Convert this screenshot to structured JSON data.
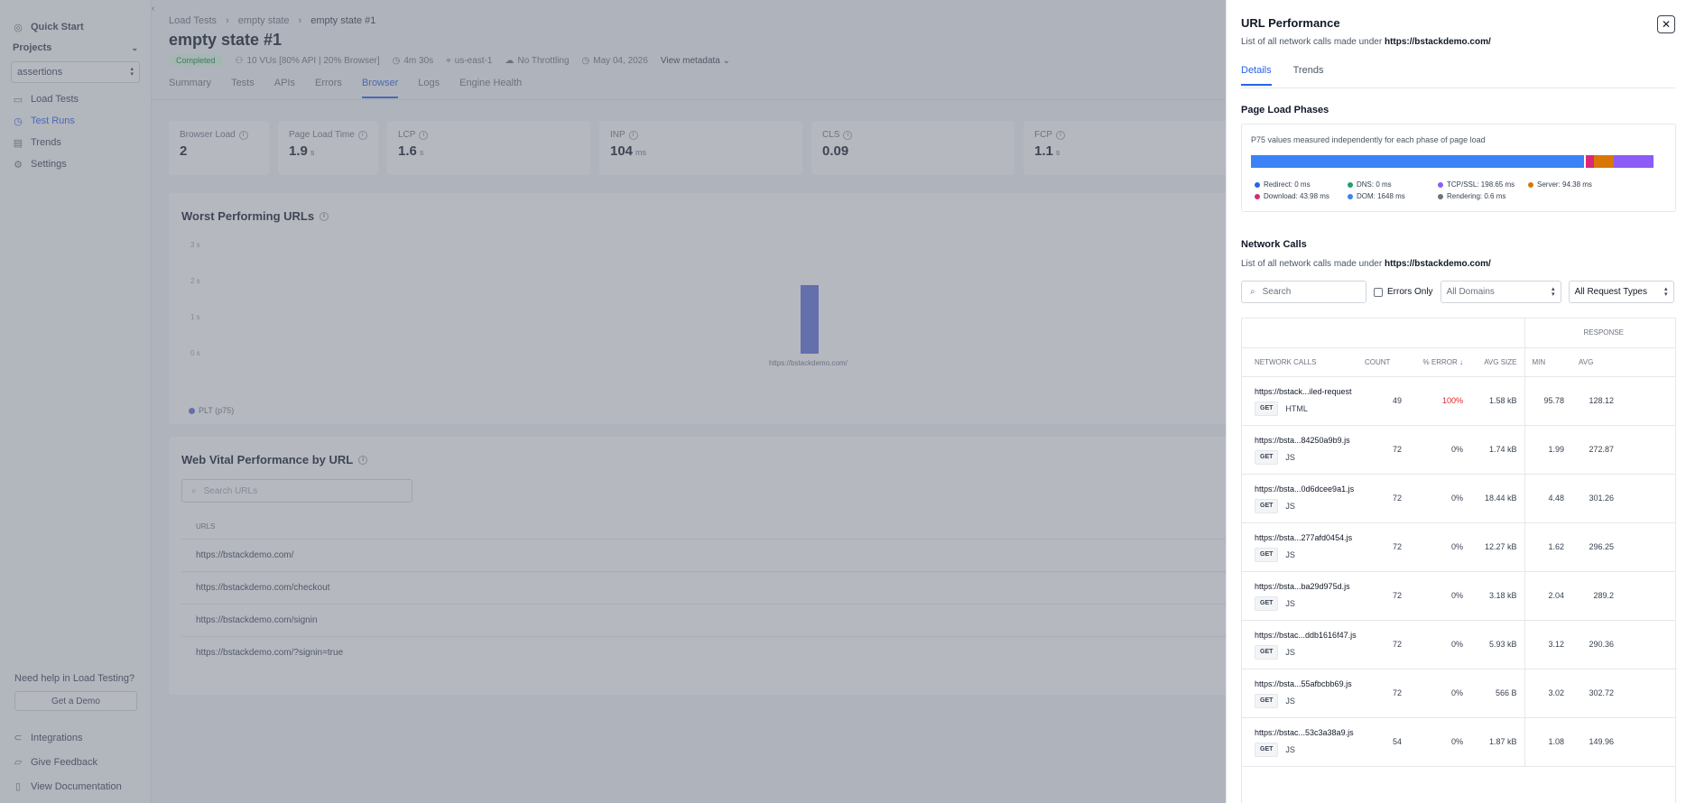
{
  "sidebar": {
    "quick_start": "Quick Start",
    "projects_label": "Projects",
    "project_value": "assertions",
    "load_tests": "Load Tests",
    "test_runs": "Test Runs",
    "trends": "Trends",
    "settings": "Settings",
    "help_text": "Need help in Load Testing?",
    "demo_button": "Get a Demo",
    "integrations": "Integrations",
    "feedback": "Give Feedback",
    "docs": "View Documentation"
  },
  "main": {
    "breadcrumb": [
      "Load Tests",
      "empty state",
      "empty state #1"
    ],
    "title": "empty state #1",
    "status": "Completed",
    "vus": "10 VUs [80% API | 20% Browser]",
    "duration": "4m 30s",
    "region": "us-east-1",
    "throttling": "No Throttling",
    "date": "May 04, 2026",
    "view_metadata": "View metadata",
    "tabs": [
      "Summary",
      "Tests",
      "APIs",
      "Errors",
      "Browser",
      "Logs",
      "Engine Health"
    ],
    "active_tab": "Browser",
    "metrics": [
      {
        "label": "Browser Load",
        "value": "2",
        "unit": ""
      },
      {
        "label": "Page Load Time",
        "value": "1.9",
        "unit": "s"
      },
      {
        "label": "LCP",
        "value": "1.6",
        "unit": "s"
      },
      {
        "label": "INP",
        "value": "104",
        "unit": "ms"
      },
      {
        "label": "CLS",
        "value": "0.09",
        "unit": ""
      },
      {
        "label": "FCP",
        "value": "1.1",
        "unit": "s"
      }
    ],
    "worst_title": "Worst Performing URLs",
    "web_vital_title": "Web Vital Performance by URL",
    "url_search_placeholder": "Search URLs",
    "url_col": "URLS",
    "urls": [
      "https://bstackdemo.com/",
      "https://bstackdemo.com/checkout",
      "https://bstackdemo.com/signin",
      "https://bstackdemo.com/?signin=true"
    ]
  },
  "chart_data": {
    "type": "bar",
    "categories": [
      "https://bstackdemo.com/"
    ],
    "series": [
      {
        "name": "PLT (p75)",
        "values": [
          1.9
        ]
      }
    ],
    "ylim": [
      0,
      3
    ],
    "yticks": [
      "0 s",
      "1 s",
      "2 s",
      "3 s"
    ],
    "color": "#5b6fd9"
  },
  "drawer": {
    "title": "URL Performance",
    "subtitle_prefix": "List of all network calls made under ",
    "subtitle_url": "https://bstackdemo.com/",
    "tabs": [
      "Details",
      "Trends"
    ],
    "active_tab": "Details",
    "phases_title": "Page Load Phases",
    "phases_note": "P75 values measured independently for each phase of page load",
    "phases": [
      {
        "label": "Redirect: 0 ms",
        "ms": 0,
        "color": "#2563eb"
      },
      {
        "label": "DNS: 0 ms",
        "ms": 0,
        "color": "#22a06b"
      },
      {
        "label": "TCP/SSL: 198.65 ms",
        "ms": 198.65,
        "color": "#8b5cf6"
      },
      {
        "label": "Server: 94.38 ms",
        "ms": 94.38,
        "color": "#d97706"
      },
      {
        "label": "Download: 43.98 ms",
        "ms": 43.98,
        "color": "#db2777"
      },
      {
        "label": "DOM: 1648 ms",
        "ms": 1648,
        "color": "#3b82f6"
      },
      {
        "label": "Rendering: 0.6 ms",
        "ms": 0.6,
        "color": "#6b7280"
      }
    ],
    "network_title": "Network Calls",
    "network_sub_prefix": "List of all network calls made under ",
    "network_sub_url": "https://bstackdemo.com/",
    "search_placeholder": "Search",
    "errors_only": "Errors Only",
    "domains_select": "All Domains",
    "types_select": "All Request Types",
    "group_response": "RESPONSE",
    "columns": [
      "NETWORK CALLS",
      "COUNT",
      "% ERROR",
      "AVG SIZE",
      "MIN",
      "AVG"
    ],
    "rows": [
      {
        "url": "https://bstack...iled-request",
        "method": "GET",
        "type": "HTML",
        "count": "49",
        "error": "100%",
        "size": "1.58 kB",
        "min": "95.78",
        "avg": "128.12",
        "is_error": true
      },
      {
        "url": "https://bsta...84250a9b9.js",
        "method": "GET",
        "type": "JS",
        "count": "72",
        "error": "0%",
        "size": "1.74 kB",
        "min": "1.99",
        "avg": "272.87",
        "is_error": false
      },
      {
        "url": "https://bsta...0d6dcee9a1.js",
        "method": "GET",
        "type": "JS",
        "count": "72",
        "error": "0%",
        "size": "18.44 kB",
        "min": "4.48",
        "avg": "301.26",
        "is_error": false
      },
      {
        "url": "https://bsta...277afd0454.js",
        "method": "GET",
        "type": "JS",
        "count": "72",
        "error": "0%",
        "size": "12.27 kB",
        "min": "1.62",
        "avg": "296.25",
        "is_error": false
      },
      {
        "url": "https://bsta...ba29d975d.js",
        "method": "GET",
        "type": "JS",
        "count": "72",
        "error": "0%",
        "size": "3.18 kB",
        "min": "2.04",
        "avg": "289.2",
        "is_error": false
      },
      {
        "url": "https://bstac...ddb1616f47.js",
        "method": "GET",
        "type": "JS",
        "count": "72",
        "error": "0%",
        "size": "5.93 kB",
        "min": "3.12",
        "avg": "290.36",
        "is_error": false
      },
      {
        "url": "https://bsta...55afbcbb69.js",
        "method": "GET",
        "type": "JS",
        "count": "72",
        "error": "0%",
        "size": "566 B",
        "min": "3.02",
        "avg": "302.72",
        "is_error": false
      },
      {
        "url": "https://bstac...53c3a38a9.js",
        "method": "GET",
        "type": "JS",
        "count": "54",
        "error": "0%",
        "size": "1.87 kB",
        "min": "1.08",
        "avg": "149.96",
        "is_error": false
      }
    ]
  }
}
